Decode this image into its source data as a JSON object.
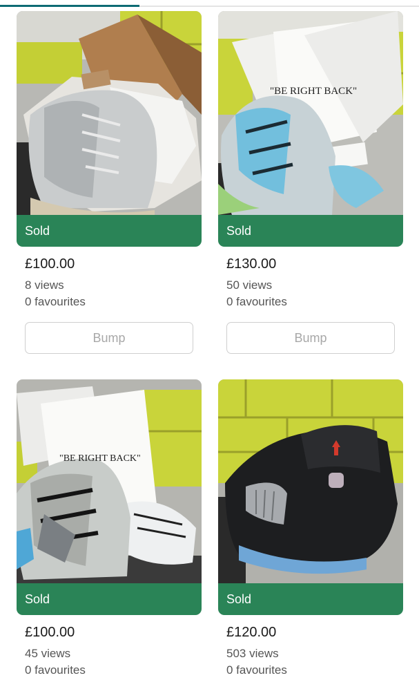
{
  "listings": [
    {
      "status": "Sold",
      "price": "£100.00",
      "views": "8 views",
      "favourites": "0 favourites",
      "action": "Bump",
      "image_icon": "sneaker-photo"
    },
    {
      "status": "Sold",
      "price": "£130.00",
      "views": "50 views",
      "favourites": "0 favourites",
      "action": "Bump",
      "box_text": "\"BE RIGHT BACK\"",
      "image_icon": "sneaker-photo"
    },
    {
      "status": "Sold",
      "price": "£100.00",
      "views": "45 views",
      "favourites": "0 favourites",
      "box_text": "\"BE RIGHT BACK\"",
      "image_icon": "sneaker-photo"
    },
    {
      "status": "Sold",
      "price": "£120.00",
      "views": "503 views",
      "favourites": "0 favourites",
      "image_icon": "sneaker-photo"
    }
  ],
  "colors": {
    "sold": "#2a8457",
    "tab_indicator": "#0d6b74",
    "tiles": "#c9d43a"
  }
}
